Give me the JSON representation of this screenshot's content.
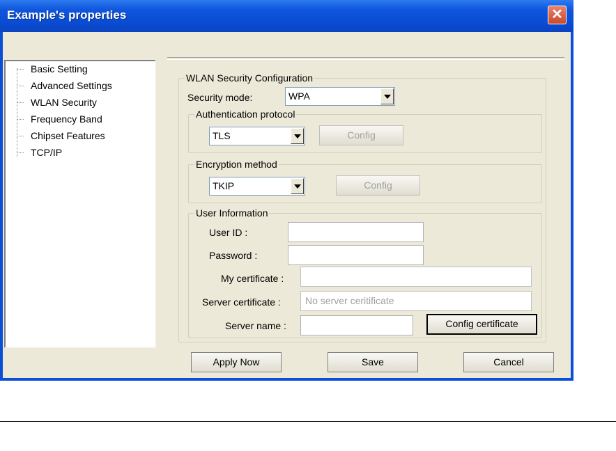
{
  "window": {
    "title": "Example's properties",
    "close_glyph": "✕"
  },
  "tree": {
    "items": [
      "Basic Setting",
      "Advanced Settings",
      "WLAN Security",
      "Frequency Band",
      "Chipset Features",
      "TCP/IP"
    ]
  },
  "wlan": {
    "legend": "WLAN Security Configuration",
    "security_mode_label": "Security mode:",
    "security_mode_value": "WPA",
    "auth": {
      "legend": "Authentication protocol",
      "value": "TLS",
      "config_label": "Config"
    },
    "enc": {
      "legend": "Encryption method",
      "value": "TKIP",
      "config_label": "Config"
    },
    "user": {
      "legend": "User Information",
      "user_id_label": "User ID :",
      "user_id_value": "",
      "password_label": "Password :",
      "password_value": "",
      "my_cert_label": "My certificate :",
      "my_cert_value": "",
      "server_cert_label": "Server certificate :",
      "server_cert_placeholder": "No server ceritificate",
      "server_name_label": "Server name :",
      "server_name_value": "",
      "config_cert_label": "Config certificate"
    }
  },
  "footer": {
    "apply_label": "Apply Now",
    "save_label": "Save",
    "cancel_label": "Cancel"
  }
}
